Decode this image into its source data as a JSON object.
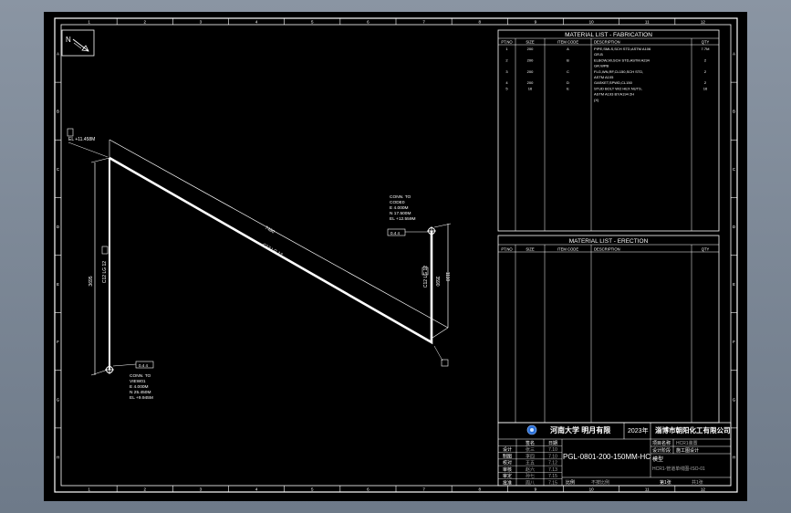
{
  "colors": {
    "background": "#7b8796",
    "sheet": "#000000",
    "line": "#ffffff",
    "accent": "#2a6fd6"
  },
  "grid": {
    "top_labels": [
      "1",
      "2",
      "3",
      "4",
      "5",
      "6",
      "7",
      "8",
      "9",
      "10",
      "11",
      "12"
    ],
    "side_labels": [
      "A",
      "B",
      "C",
      "D",
      "E",
      "F",
      "G",
      "H"
    ]
  },
  "north": {
    "label": "N"
  },
  "drawing": {
    "line_no": "PGL-0801-200-150MM-HC",
    "dim_vertical_left": "3695",
    "dim_diagonal": "7480",
    "dim_vertical_right": "1110",
    "top_elev": "EL +11.458M",
    "left_vertical_tag": "C12 LG 12",
    "diagonal_tag": "C12 LG 12",
    "right_vertical_tag": "C12 LG 12",
    "right_side_text": "3590",
    "conn_top": [
      "CONN. TO",
      "CODE0",
      "E 4.000M",
      "N 17.500M",
      "EL +12.559M"
    ],
    "conn_bottom": [
      "CONN. TO",
      "VIEW01",
      "E 4.000M",
      "N 25.450M",
      "EL +9.945M"
    ],
    "flag_right": "0.4 4",
    "flag_bottom": "0.4 4"
  },
  "mat_fab": {
    "title": "MATERIAL LIST - FABRICATION",
    "headers": [
      "PT.NO",
      "SIZE",
      "ITEM CODE",
      "DESCRIPTION",
      "QTY"
    ],
    "rows": [
      [
        "1",
        "200",
        "A",
        "PIPE,SMLS,SCH STD,ASTM A106",
        "7.7M"
      ],
      [
        "",
        "",
        "",
        "GR.B",
        ""
      ],
      [
        "2",
        "200",
        "B",
        "ELBOW,90,SCH STD,ASTM A234",
        "2"
      ],
      [
        "",
        "",
        "",
        "GR.WPB",
        ""
      ],
      [
        "3",
        "200",
        "C",
        "FLG,WN,RF,CL150,SCH STD,",
        "2"
      ],
      [
        "",
        "",
        "",
        "ASTM A105",
        ""
      ],
      [
        "4",
        "200",
        "D",
        "GASKET,SPWD,CL150",
        "2"
      ],
      [
        "5",
        "16",
        "E",
        "STUD BOLT W/2 HEX NUTS,",
        "16"
      ],
      [
        "",
        "",
        "",
        "ASTM A193 B7/A194 2H",
        ""
      ],
      [
        "",
        "",
        "",
        "(X)",
        ""
      ]
    ]
  },
  "mat_erect": {
    "title": "MATERIAL LIST - ERECTION",
    "headers": [
      "PT.NO",
      "SIZE",
      "ITEM CODE",
      "DESCRIPTION",
      "QTY"
    ]
  },
  "title_block": {
    "university": "河南大学 明月有限",
    "year": "2023年",
    "company": "淄博市朝阳化工有限公司",
    "drawing_no": "PGL-0801-200-150MM-HC",
    "doc_name": "模型",
    "drawing_name": "HCR1-管道单线图-ISO-01",
    "sign_roles": [
      "设计",
      "制图",
      "校对",
      "审核",
      "审定",
      "批准"
    ],
    "sign_names": [
      "张三",
      "李四",
      "王五",
      "赵六",
      "孙七",
      "周八"
    ],
    "dates": [
      "7.10",
      "7.10",
      "7.12",
      "7.13",
      "7.15",
      "7.15"
    ],
    "col_heads": [
      "签名",
      "日期"
    ],
    "project_label": "项目名称",
    "project_value": "HCR1装置",
    "stage_label": "设计阶段",
    "stage_value": "施工图设计",
    "scale_label": "比例",
    "scale_value": "不按比例",
    "sheet_label": "第1张",
    "total_label": "共1张"
  }
}
